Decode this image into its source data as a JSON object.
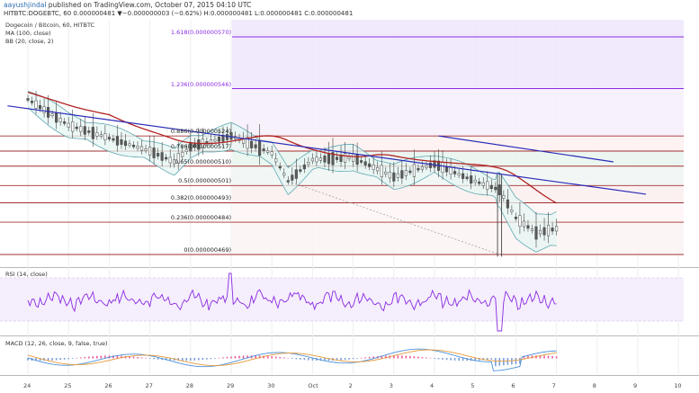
{
  "header": {
    "author": "aayushjindal",
    "published": "published on TradingView.com, October 07, 2015 04:10 UTC",
    "ohlc": "HITBTC:DOGEBTC, 60  0.000000481  ▼−0.000000003 (−0.62%)  H:0.000000481  L:0.000000481  C:0.000000481"
  },
  "main_panel": {
    "title": "Dogecoin / Bitcoin, 60, HITBTC",
    "indicator_1": "MA (100, close)",
    "indicator_2": "BB (20, close, 2)"
  },
  "rsi_panel": {
    "label": "RSI (14, close)"
  },
  "macd_panel": {
    "label": "MACD (12, 26, close, 9, false, true)"
  },
  "colors": {
    "candle": "#444444",
    "ma": "#b22222",
    "bb": "#5fa8b0",
    "bb_fill": "#e6f5f3",
    "trendline": "#2a2ab8",
    "fib_line": "#a03030",
    "fib_ext": "#8a2be2",
    "rsi": "#8a2be2",
    "macd": "#4a90d9",
    "signal": "#e69a3a",
    "hist_pos": "#e85a9a",
    "hist_neg": "#7aa0d8"
  },
  "chart_data": {
    "type": "candlestick",
    "x_axis_ticks": [
      "24",
      "25",
      "26",
      "27",
      "28",
      "29",
      "30",
      "Oct",
      "2",
      "3",
      "4",
      "5",
      "6",
      "7",
      "8",
      "9",
      "10"
    ],
    "fibonacci_levels": [
      {
        "ratio": "1.618",
        "price": 5.7e-07
      },
      {
        "ratio": "1.236",
        "price": 5.46e-07
      },
      {
        "ratio": "0.886",
        "price": 5.24e-07
      },
      {
        "ratio": "0.786",
        "price": 5.17e-07
      },
      {
        "ratio": "0.65",
        "price": 5.1e-07
      },
      {
        "ratio": "0.5",
        "price": 5.01e-07
      },
      {
        "ratio": "0.382",
        "price": 4.93e-07
      },
      {
        "ratio": "0.236",
        "price": 4.84e-07
      },
      {
        "ratio": "0",
        "price": 4.69e-07
      }
    ],
    "fib_labels": [
      "1.618(0.000000570)",
      "1.236(0.000000546)",
      "0.886(0.000000524)",
      "0.786(0.000000517)",
      "0.65(0.000000510)",
      "0.5(0.000000501)",
      "0.382(0.000000493)",
      "0.236(0.000000484)",
      "0(0.000000469)"
    ],
    "price_path": [
      {
        "day": 24.0,
        "price": 5.41e-07
      },
      {
        "day": 25.0,
        "price": 5.29e-07
      },
      {
        "day": 26.0,
        "price": 5.23e-07
      },
      {
        "day": 27.0,
        "price": 5.17e-07
      },
      {
        "day": 27.6,
        "price": 5.12e-07
      },
      {
        "day": 28.0,
        "price": 5.19e-07
      },
      {
        "day": 29.0,
        "price": 5.24e-07
      },
      {
        "day": 30.0,
        "price": 5.16e-07
      },
      {
        "day": 30.4,
        "price": 5.03e-07
      },
      {
        "day": 31.0,
        "price": 5.13e-07
      },
      {
        "day": 32.0,
        "price": 5.14e-07
      },
      {
        "day": 33.0,
        "price": 5.05e-07
      },
      {
        "day": 34.0,
        "price": 5.11e-07
      },
      {
        "day": 35.0,
        "price": 5.03e-07
      },
      {
        "day": 35.6,
        "price": 4.99e-07
      },
      {
        "day": 36.0,
        "price": 4.86e-07
      },
      {
        "day": 36.5,
        "price": 4.79e-07
      },
      {
        "day": 37.0,
        "price": 4.81e-07
      }
    ],
    "trendlines": [
      {
        "from": {
          "day": 23.5,
          "price": 5.38e-07
        },
        "to": {
          "day": 39.2,
          "price": 4.97e-07
        }
      },
      {
        "from": {
          "day": 34.1,
          "price": 5.24e-07
        },
        "to": {
          "day": 38.4,
          "price": 5.12e-07
        }
      }
    ]
  }
}
